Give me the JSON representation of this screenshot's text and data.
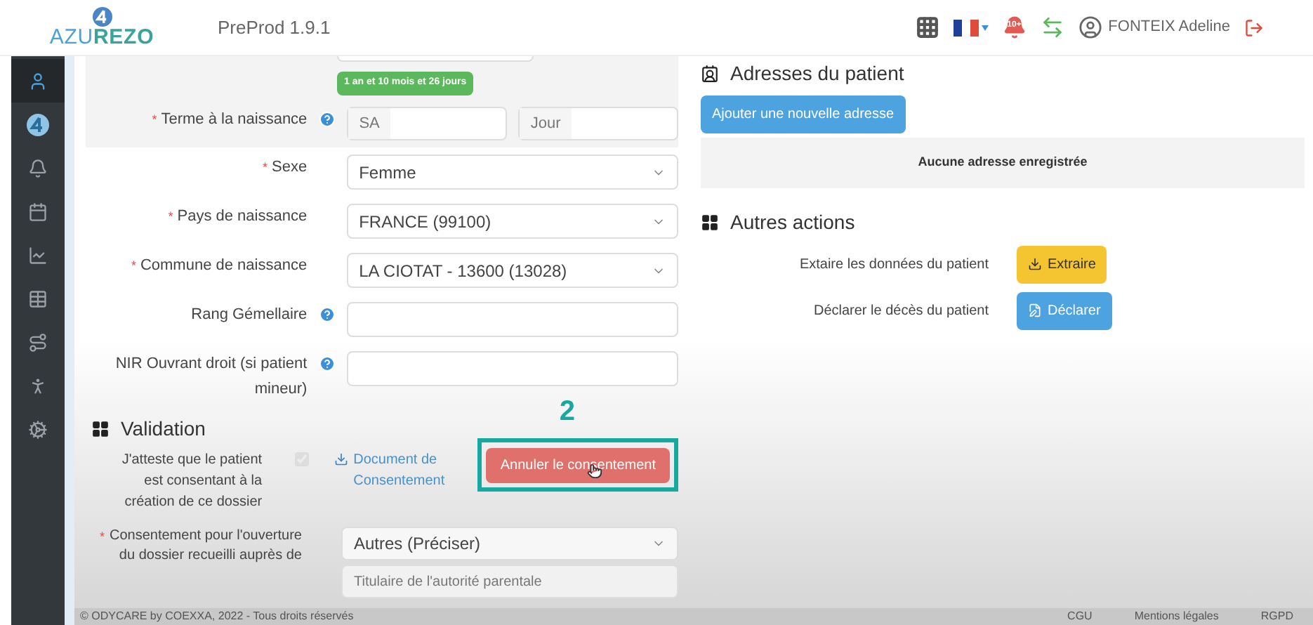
{
  "header": {
    "logo_part_a": "AZU",
    "logo_part_b": "REZO",
    "env": "PreProd 1.9.1",
    "notification_count": "10+",
    "user_name": "FONTEIX Adeline"
  },
  "sidebar": {
    "items": [
      {
        "selected": true
      },
      {
        "selected": false
      },
      {
        "selected": false
      },
      {
        "selected": false
      },
      {
        "selected": false
      },
      {
        "selected": false
      },
      {
        "selected": false
      },
      {
        "selected": false
      },
      {
        "selected": false
      }
    ]
  },
  "age_badge": "1 an et 10 mois et 26 jours",
  "required_marker": "*",
  "form_rows": [
    {
      "kind": "term",
      "label": "Terme à la naissance",
      "required": true,
      "help": true,
      "addon_1": "SA",
      "addon_2": "Jour"
    },
    {
      "kind": "select",
      "label": "Sexe",
      "required": true,
      "help": false,
      "value": "Femme"
    },
    {
      "kind": "select",
      "label": "Pays de naissance",
      "required": true,
      "help": false,
      "value": "FRANCE (99100)"
    },
    {
      "kind": "select",
      "label": "Commune de naissance",
      "required": true,
      "help": false,
      "value": "LA CIOTAT - 13600 (13028)"
    },
    {
      "kind": "input",
      "label": "Rang Gémellaire",
      "required": false,
      "help": true
    },
    {
      "kind": "input",
      "label": "NIR Ouvrant droit (si patient mineur)",
      "required": false,
      "help": true
    }
  ],
  "validation": {
    "title": "Validation",
    "attest_label": "J'atteste que le patient est consentant à la création de ce dossier",
    "checkbox": {
      "checked": true,
      "disabled": true
    },
    "document_link": "Document de Consentement",
    "cancel_button": "Annuler le consentement",
    "annotation": "2",
    "consent_label": "Consentement pour l'ouverture du dossier recueilli auprès de",
    "consent_value": "Autres (Préciser)",
    "consent_detail_placeholder": "Titulaire de l'autorité parentale"
  },
  "addresses": {
    "title": "Adresses du patient",
    "add_button": "Ajouter une nouvelle adresse",
    "empty": "Aucune adresse enregistrée"
  },
  "other_actions": {
    "title": "Autres actions",
    "actions": [
      {
        "kind": "extract",
        "label": "Extaire les données du patient",
        "button": "Extraire"
      },
      {
        "kind": "declare",
        "label": "Déclarer le décès du patient",
        "button": "Déclarer"
      }
    ]
  },
  "footer": {
    "copyright": "© ODYCARE by COEXXA, 2022 - Tous droits réservés",
    "links": [
      "CGU",
      "Mentions légales",
      "RGPD"
    ]
  }
}
